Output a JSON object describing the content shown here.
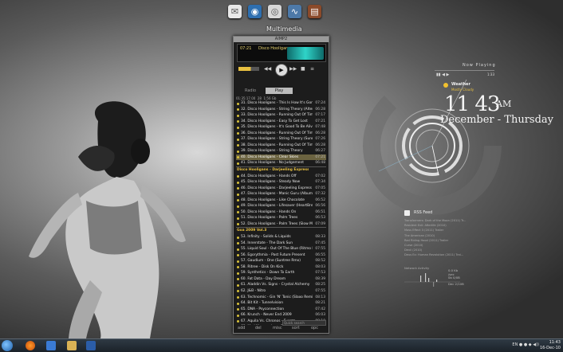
{
  "dock": {
    "label": "Multimedia",
    "icons": [
      "mail-icon",
      "browser-icon",
      "disc-icon",
      "waveform-icon",
      "notebook-icon"
    ]
  },
  "player": {
    "title": "AIMP2",
    "time": "07:21",
    "track": "Disco Hooligans",
    "tabs": [
      "Radio",
      "Play"
    ],
    "playlist_header": [
      "01:35:17.00",
      "28",
      "1:56 Gb"
    ],
    "rows": [
      {
        "n": "31.",
        "t": "Disco Hooligans - This Is How It's Gonna...",
        "d": "07:24",
        "g": false,
        "sel": false
      },
      {
        "n": "32.",
        "t": "Disco Hooligans - String Theory (Alterr...",
        "d": "06:28",
        "g": false,
        "sel": false
      },
      {
        "n": "33.",
        "t": "Disco Hooligans - Running Out Of Tim...",
        "d": "07:17",
        "g": false,
        "sel": false
      },
      {
        "n": "34.",
        "t": "Disco Hooligans - Easy To Get Lost",
        "d": "07:21",
        "g": false,
        "sel": false
      },
      {
        "n": "35.",
        "t": "Disco Hooligans - It's Good To Be Alive",
        "d": "07:48",
        "g": false,
        "sel": false
      },
      {
        "n": "36.",
        "t": "Disco Hooligans - Running Out Of Time",
        "d": "06:28",
        "g": false,
        "sel": false
      },
      {
        "n": "37.",
        "t": "Disco Hooligans - String Theory (Sunrise...",
        "d": "07:26",
        "g": false,
        "sel": false
      },
      {
        "n": "38.",
        "t": "Disco Hooligans - Running Out Of Time...",
        "d": "06:28",
        "g": false,
        "sel": false
      },
      {
        "n": "39.",
        "t": "Disco Hooligans - String Theory",
        "d": "06:27",
        "g": false,
        "sel": false
      },
      {
        "n": "40.",
        "t": "Disco Hooligans - Clear Skies",
        "d": "07:21",
        "g": false,
        "sel": true
      },
      {
        "n": "41.",
        "t": "Disco Hooligans - No Judgement",
        "d": "06:48",
        "g": false,
        "sel": false
      },
      {
        "n": "",
        "t": "Disco Hooligans - Darjeeling Express (2010)",
        "d": "",
        "g": true,
        "sel": false
      },
      {
        "n": "44.",
        "t": "Disco Hooligans - Hands Off",
        "d": "07:02",
        "g": false,
        "sel": false
      },
      {
        "n": "45.",
        "t": "Disco Hooligans - Steady Now",
        "d": "07:34",
        "g": false,
        "sel": false
      },
      {
        "n": "46.",
        "t": "Disco Hooligans - Darjeeling Express",
        "d": "07:05",
        "g": false,
        "sel": false
      },
      {
        "n": "47.",
        "t": "Disco Hooligans - Manic Guru (Album...",
        "d": "07:32",
        "g": false,
        "sel": false
      },
      {
        "n": "48.",
        "t": "Disco Hooligans - Like Chocolate",
        "d": "06:52",
        "g": false,
        "sel": false
      },
      {
        "n": "49.",
        "t": "Disco Hooligans - Lifesaver (HeartBrea...",
        "d": "06:56",
        "g": false,
        "sel": false
      },
      {
        "n": "50.",
        "t": "Disco Hooligans - Hands On",
        "d": "06:51",
        "g": false,
        "sel": false
      },
      {
        "n": "51.",
        "t": "Disco Hooligans - Palm Trees",
        "d": "06:53",
        "g": false,
        "sel": false
      },
      {
        "n": "52.",
        "t": "Disco Hooligans - Palm Trees (Slow M...",
        "d": "07:09",
        "g": false,
        "sel": false
      },
      {
        "n": "",
        "t": "Goa 2009 Vol.3",
        "d": "",
        "g": true,
        "sel": false
      },
      {
        "n": "53.",
        "t": "Infinity - Solids & Liquids",
        "d": "08:33",
        "g": false,
        "sel": false
      },
      {
        "n": "54.",
        "t": "Innerstate - The Dark Sun",
        "d": "07:45",
        "g": false,
        "sel": false
      },
      {
        "n": "55.",
        "t": "Liquid Soul - Out Of The Blue (Ritmo R...",
        "d": "07:55",
        "g": false,
        "sel": false
      },
      {
        "n": "56.",
        "t": "Egorythmia - Past Future Present",
        "d": "06:55",
        "g": false,
        "sel": false
      },
      {
        "n": "57.",
        "t": "Gaudium - One (Suntree Rmx)",
        "d": "08:52",
        "g": false,
        "sel": false
      },
      {
        "n": "58.",
        "t": "Ritree - Disk On Kick",
        "d": "08:03",
        "g": false,
        "sel": false
      },
      {
        "n": "59.",
        "t": "Synthetics - Down To Earth",
        "d": "07:53",
        "g": false,
        "sel": false
      },
      {
        "n": "60.",
        "t": "Fat Data - Day Dream",
        "d": "08:39",
        "g": false,
        "sel": false
      },
      {
        "n": "61.",
        "t": "Aladdin Vs. Signs - Crystal Alchemy",
        "d": "08:25",
        "g": false,
        "sel": false
      },
      {
        "n": "62.",
        "t": "J&B - Nitro",
        "d": "07:55",
        "g": false,
        "sel": false
      },
      {
        "n": "63.",
        "t": "Technomic - Gin 'N' Tonic (Slaxo Remix)",
        "d": "08:13",
        "g": false,
        "sel": false
      },
      {
        "n": "64.",
        "t": "Bit Kit - Tunnelvision",
        "d": "08:21",
        "g": false,
        "sel": false
      },
      {
        "n": "65.",
        "t": "DNA - Psyconnection",
        "d": "07:42",
        "g": false,
        "sel": false
      },
      {
        "n": "66.",
        "t": "Krunch - Never End 2009",
        "d": "06:03",
        "g": false,
        "sel": false
      },
      {
        "n": "67.",
        "t": "Aquila Vs. Chronos - Fuerza",
        "d": "08:10",
        "g": false,
        "sel": false
      },
      {
        "n": "68.",
        "t": "Mad Mango - Luna De Sangre (Unrele...",
        "d": "08:35",
        "g": false,
        "sel": false
      },
      {
        "n": "69.",
        "t": "Sirion - Take Control (Unreleased)",
        "d": "07:46",
        "g": false,
        "sel": false
      }
    ],
    "search_placeholder": "Quick search",
    "footer_buttons": [
      "add",
      "del",
      "misc",
      "sort",
      "opc"
    ]
  },
  "now_playing": {
    "label": "Now Playing",
    "time": "1:33"
  },
  "weather": {
    "title": "Weather",
    "condition": "Mostly Cloudy"
  },
  "clock": {
    "hour": "11",
    "minute": "43",
    "ampm": "AM",
    "date": "December - Thursday"
  },
  "rss": {
    "title": "RSS Feed",
    "items": [
      "Transformers: Dark of the Moon (2011) Tr...",
      "Resident Evil: Afterlife (2010)",
      "Mass Effect 3 (2011) Trailer",
      "The American (2010)",
      "Red Riding Hood (2011) Trailer",
      "Curse (2010)",
      "Devil (2010)",
      "Deus Ex: Human Revolution (2011) Trai..."
    ]
  },
  "network": {
    "label": "Network Activity",
    "up": "0.0 Kb /sec",
    "down": "0b 0/0B",
    "total": "Dec 2/10B"
  },
  "taskbar": {
    "lang": "EN",
    "time": "11:43",
    "date": "16-Dec-10"
  },
  "colors": {
    "accent": "#e8c040",
    "selected": "#6b6340"
  }
}
